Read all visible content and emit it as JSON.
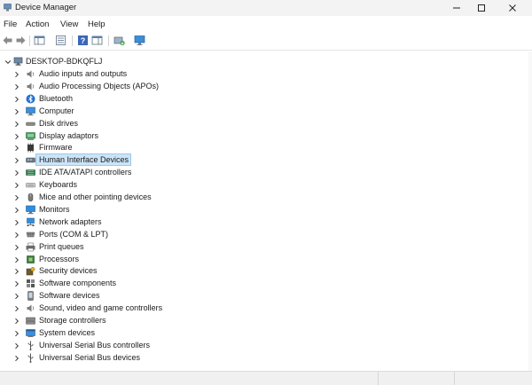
{
  "window": {
    "title": "Device Manager"
  },
  "menu": {
    "file": "File",
    "action": "Action",
    "view": "View",
    "help": "Help"
  },
  "toolbar": [
    "back-icon",
    "forward-icon",
    "show-hide-console-tree-icon",
    "properties-icon",
    "help-icon",
    "action-pane-icon",
    "update-driver-icon",
    "monitor-icon"
  ],
  "tree": {
    "root": "DESKTOP-BDKQFLJ",
    "items": [
      {
        "label": "Audio inputs and outputs",
        "icon": "speaker-icon"
      },
      {
        "label": "Audio Processing Objects (APOs)",
        "icon": "speaker-icon"
      },
      {
        "label": "Bluetooth",
        "icon": "bluetooth-icon"
      },
      {
        "label": "Computer",
        "icon": "computer-icon"
      },
      {
        "label": "Disk drives",
        "icon": "disk-drive-icon"
      },
      {
        "label": "Display adaptors",
        "icon": "display-adapter-icon"
      },
      {
        "label": "Firmware",
        "icon": "chip-icon"
      },
      {
        "label": "Human Interface Devices",
        "icon": "hid-icon"
      },
      {
        "label": "IDE ATA/ATAPI controllers",
        "icon": "ide-controller-icon"
      },
      {
        "label": "Keyboards",
        "icon": "keyboard-icon"
      },
      {
        "label": "Mice and other pointing devices",
        "icon": "mouse-icon"
      },
      {
        "label": "Monitors",
        "icon": "monitor-icon"
      },
      {
        "label": "Network adapters",
        "icon": "network-icon"
      },
      {
        "label": "Ports (COM & LPT)",
        "icon": "port-icon"
      },
      {
        "label": "Print queues",
        "icon": "printer-icon"
      },
      {
        "label": "Processors",
        "icon": "processor-icon"
      },
      {
        "label": "Security devices",
        "icon": "security-icon"
      },
      {
        "label": "Software components",
        "icon": "software-component-icon"
      },
      {
        "label": "Software devices",
        "icon": "software-device-icon"
      },
      {
        "label": "Sound, video and game controllers",
        "icon": "speaker-icon"
      },
      {
        "label": "Storage controllers",
        "icon": "storage-controller-icon"
      },
      {
        "label": "System devices",
        "icon": "system-devices-icon"
      },
      {
        "label": "Universal Serial Bus controllers",
        "icon": "usb-icon"
      },
      {
        "label": "Universal Serial Bus devices",
        "icon": "usb-icon"
      }
    ],
    "selected_index": 7
  },
  "colors": {
    "selection": "#cce4f7",
    "selection_border": "#99c9ef",
    "titlebar": "#f3f3f3"
  }
}
